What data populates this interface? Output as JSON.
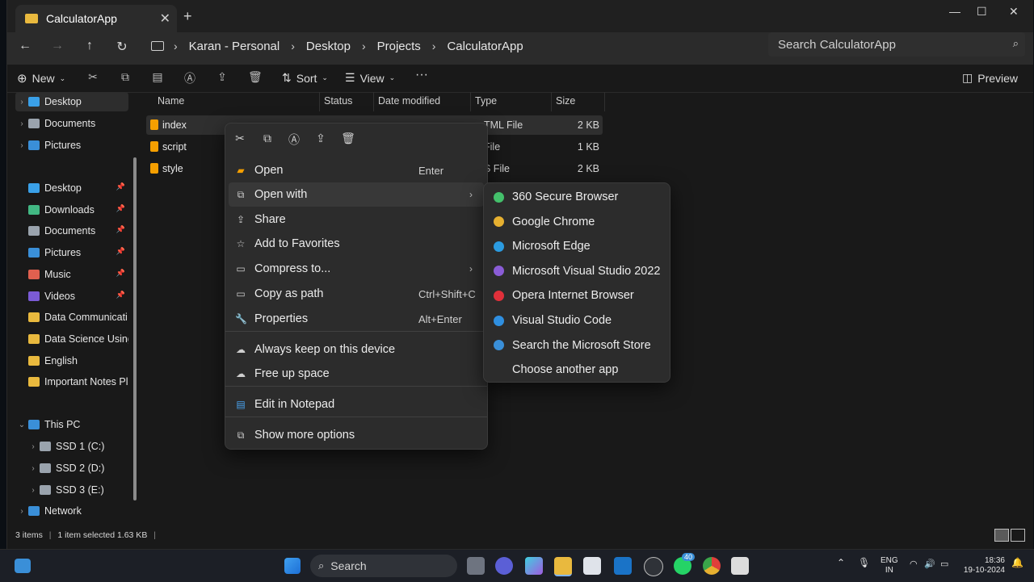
{
  "window": {
    "tab_title": "CalculatorApp",
    "new_tab": "+",
    "close_tab": "✕",
    "controls": [
      "—",
      "☐",
      "✕"
    ]
  },
  "address": {
    "breadcrumbs": [
      "Karan - Personal",
      "Desktop",
      "Projects",
      "CalculatorApp"
    ],
    "search_placeholder": "Search CalculatorApp"
  },
  "toolbar": {
    "new_label": "New",
    "sort_label": "Sort",
    "view_label": "View",
    "more": "···",
    "preview_label": "Preview"
  },
  "sidebar": {
    "top": [
      {
        "label": "Desktop",
        "color": "#3aa0e8",
        "selected": true
      },
      {
        "label": "Documents",
        "color": "#9aa3ad"
      },
      {
        "label": "Pictures",
        "color": "#3a8fd8"
      }
    ],
    "quick": [
      {
        "label": "Desktop",
        "color": "#3aa0e8",
        "pinned": true
      },
      {
        "label": "Downloads",
        "color": "#42b883",
        "pinned": true
      },
      {
        "label": "Documents",
        "color": "#9aa3ad",
        "pinned": true
      },
      {
        "label": "Pictures",
        "color": "#3a8fd8",
        "pinned": true
      },
      {
        "label": "Music",
        "color": "#e0604f",
        "pinned": true
      },
      {
        "label": "Videos",
        "color": "#7b5bd6",
        "pinned": true
      },
      {
        "label": "Data Communicati",
        "color": "#e9b93e"
      },
      {
        "label": "Data Science Using",
        "color": "#e9b93e"
      },
      {
        "label": "English",
        "color": "#e9b93e"
      },
      {
        "label": "Important Notes Pl",
        "color": "#e9b93e"
      }
    ],
    "this_pc": "This PC",
    "drives": [
      "SSD 1 (C:)",
      "SSD 2 (D:)",
      "SSD 3 (E:)"
    ],
    "network": "Network"
  },
  "columns": [
    "Name",
    "Status",
    "Date modified",
    "Type",
    "Size"
  ],
  "files": [
    {
      "name": "index",
      "type": "TML File",
      "size": "2 KB",
      "selected": true
    },
    {
      "name": "script",
      "type": "File",
      "size": "1 KB"
    },
    {
      "name": "style",
      "type": "S File",
      "size": "2 KB"
    }
  ],
  "status": {
    "items": "3 items",
    "selected": "1 item selected  1.63 KB"
  },
  "context_menu": {
    "items": [
      {
        "label": "Open",
        "accel": "Enter",
        "icon": "sublime-icon"
      },
      {
        "label": "Open with",
        "accel": "",
        "icon": "open-with-icon",
        "submenu": true,
        "hover": true
      },
      {
        "label": "Share",
        "accel": "",
        "icon": "share-icon"
      },
      {
        "label": "Add to Favorites",
        "accel": "",
        "icon": "star-icon"
      },
      {
        "label": "Compress to...",
        "accel": "",
        "icon": "zip-icon",
        "submenu": true
      },
      {
        "label": "Copy as path",
        "accel": "Ctrl+Shift+C",
        "icon": "path-icon"
      },
      {
        "label": "Properties",
        "accel": "Alt+Enter",
        "icon": "wrench-icon"
      },
      {
        "label": "Always keep on this device",
        "accel": "",
        "icon": "cloud-check-icon"
      },
      {
        "label": "Free up space",
        "accel": "",
        "icon": "cloud-icon"
      },
      {
        "label": "Edit in Notepad",
        "accel": "",
        "icon": "notepad-icon"
      },
      {
        "label": "Show more options",
        "accel": "",
        "icon": "more-options-icon"
      }
    ]
  },
  "open_with": [
    {
      "label": "360 Secure Browser",
      "color": "#44c06b"
    },
    {
      "label": "Google Chrome",
      "color": "#e6b030"
    },
    {
      "label": "Microsoft Edge",
      "color": "#2b9be0"
    },
    {
      "label": "Microsoft Visual Studio 2022",
      "color": "#8a5cd6"
    },
    {
      "label": "Opera Internet Browser",
      "color": "#e0303a"
    },
    {
      "label": "Visual Studio Code",
      "color": "#2f8fe0"
    },
    {
      "label": "Search the Microsoft Store",
      "color": "#3a8fd8"
    },
    {
      "label": "Choose another app",
      "color": ""
    }
  ],
  "taskbar": {
    "search_placeholder": "Search",
    "badge": "40",
    "lang_top": "ENG",
    "lang_bottom": "IN",
    "time": "18:36",
    "date": "19-10-2024"
  }
}
